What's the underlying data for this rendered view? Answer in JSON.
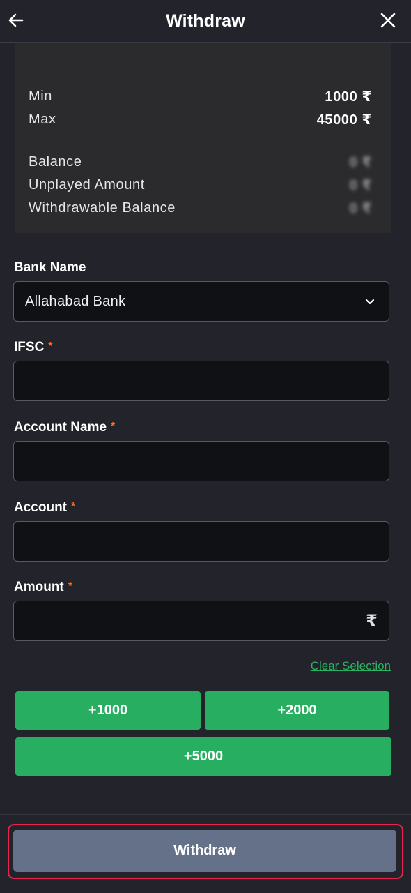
{
  "header": {
    "title": "Withdraw",
    "back_icon": "arrow-left-icon",
    "close_icon": "close-icon"
  },
  "limits": {
    "min_label": "Min",
    "min_value": "1000 ₹",
    "max_label": "Max",
    "max_value": "45000 ₹",
    "balance_label": "Balance",
    "balance_value": "0 ₹",
    "unplayed_label": "Unplayed Amount",
    "unplayed_value": "0 ₹",
    "withdrawable_label": "Withdrawable Balance",
    "withdrawable_value": "0 ₹"
  },
  "form": {
    "bank_name_label": "Bank Name",
    "bank_name_value": "Allahabad Bank",
    "ifsc_label": "IFSC",
    "account_name_label": "Account Name",
    "account_label": "Account",
    "amount_label": "Amount",
    "required_mark": "*",
    "currency_symbol": "₹"
  },
  "quick_amounts": {
    "clear_label": "Clear Selection",
    "buttons": [
      "+1000",
      "+2000",
      "+5000"
    ]
  },
  "footer": {
    "withdraw_label": "Withdraw"
  },
  "colors": {
    "accent_green": "#27ae60",
    "required": "#ff6a1a",
    "highlight": "#e8244f",
    "button_disabled": "#657189"
  }
}
